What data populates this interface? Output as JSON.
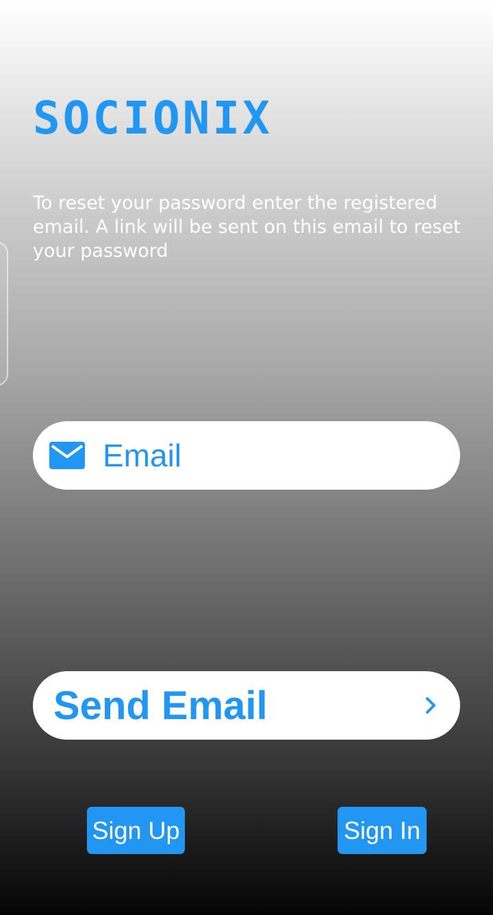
{
  "app": {
    "brand": "SOCIONIX"
  },
  "reset": {
    "instructions": "To reset your password enter the registered email. A link will be sent on this email to reset your password"
  },
  "email_field": {
    "icon": "mail-icon",
    "placeholder": "Email",
    "value": ""
  },
  "send_button": {
    "label": "Send Email",
    "icon": "chevron-right-icon"
  },
  "footer": {
    "sign_up_label": "Sign Up",
    "sign_in_label": "Sign In"
  },
  "colors": {
    "accent": "#2196f3",
    "background_top": "#ffffff",
    "background_bottom": "#050505"
  }
}
